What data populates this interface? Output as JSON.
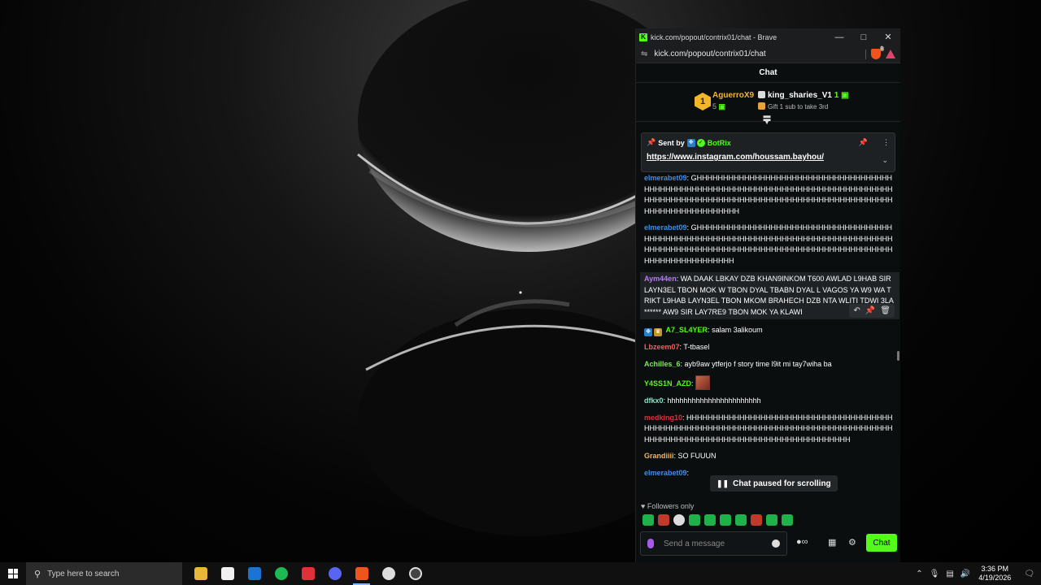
{
  "browser": {
    "window_title": "kick.com/popout/contrix01/chat - Brave",
    "url": "kick.com/popout/contrix01/chat",
    "shield_count": "1"
  },
  "chat": {
    "header": "Chat",
    "leaderboard": {
      "first_rank": "1",
      "first_name": "AguerroX9",
      "first_count": "5",
      "second_name": "king_sharies_V1",
      "second_count": "1",
      "second_sub": "Gift 1 sub to take 3rd"
    },
    "pinned": {
      "sent_by": "Sent by",
      "bot": "BotRix",
      "link": "https://www.instagram.com/houssam.bayhou/"
    },
    "messages": [
      {
        "user": "elmerabet09",
        "color": "#3e8fe6",
        "text": "GHHHHHHHHHHHHHHHHHHHHHHHHHHHHHHHHHHHHHHHHHHHHHHHHHHHHHHHHHHHHHHHHHHHHHHHHHHHHHHHHHHHHHHHHHHHHHHHHHHHHHHHHHHHHHHHHHHHHHHHHHHHHHHHHHHHHHHHHHHHHHHHHHHHHH"
      },
      {
        "user": "elmerabet09",
        "color": "#3e8fe6",
        "text": "GHHHHHHHHHHHHHHHHHHHHHHHHHHHHHHHHHHHHHHHHHHHHHHHHHHHHHHHHHHHHHHHHHHHHHHHHHHHHHHHHHHHHHHHHHHHHHHHHHHHHHHHHHHHHHHHHHHHHHHHHHHHHHHHHHHHHHHHHHHHHHHHHHHHH"
      },
      {
        "user": "Aym44en",
        "color": "#b67cf0",
        "text": "WA DAAK LBKAY DZB KHAN9INKOM T600 AWLAD L9HAB SIR LAYN3EL TBON MOK W TBON DYAL TBABN DYAL L VAGOS YA W9 WA TRIKT L9HAB LAYN3EL TBON MKOM BRAHECH DZB NTA WLITI TDWI 3LA ****** AW9 SIR LAY7RE9 TBON MOK YA KLAWI"
      },
      {
        "user": "A7_SL4YER",
        "color": "#53fc18",
        "text": "salam 3alikoum"
      },
      {
        "user": "Lbzeem07",
        "color": "#ff5a5a",
        "text": "T-tbasel"
      },
      {
        "user": "Achilles_6",
        "color": "#7fe85a",
        "text": "ayb9aw ytferjo f story time l9it mi tay7wiha ba"
      },
      {
        "user": "Y4SS1N_AZD",
        "color": "#53fc18",
        "text": ""
      },
      {
        "user": "dfkx0",
        "color": "#7fe8c8",
        "text": "hhhhhhhhhhhhhhhhhhhhhhh"
      },
      {
        "user": "medking10",
        "color": "#e0303a",
        "text": "HHHHHHHHHHHHHHHHHHHHHHHHHHHHHHHHHHHHHHHHHHHHHHHHHHHHHHHHHHHHHHHHHHHHHHHHHHHHHHHHHHHHHHHHHHHHHHHHHHHHHHHHHHHHHHHHHHHHHHHHHHHHH"
      },
      {
        "user": "Grandiiii",
        "color": "#f0b65a",
        "text": "SO FUUUN"
      },
      {
        "user": "elmerabet09",
        "color": "#3e8fe6",
        "text": ""
      }
    ],
    "paused": "Chat paused for scrolling",
    "followers_only": "Followers only",
    "input_placeholder": "Send a message",
    "send_label": "Chat"
  },
  "taskbar": {
    "search_placeholder": "Type here to search",
    "time": "3:36 PM",
    "date": "4/19/2026"
  },
  "colors": {
    "kick_green": "#53fc18",
    "brave_orange": "#f0531c"
  }
}
